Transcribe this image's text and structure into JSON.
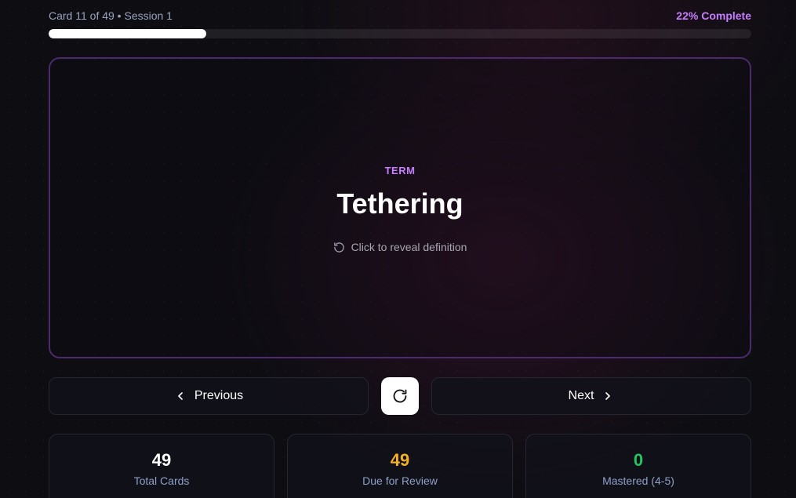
{
  "header": {
    "card_position": "Card 11 of 49 • Session 1",
    "completion_label": "22% Complete",
    "progress_fraction": 0.224
  },
  "card": {
    "label": "TERM",
    "term": "Tethering",
    "hint": "Click to reveal definition",
    "hint_icon": "rotate-icon"
  },
  "navigation": {
    "previous_label": "Previous",
    "next_label": "Next",
    "flip_icon": "rotate-icon"
  },
  "stats": [
    {
      "value": "49",
      "label": "Total Cards",
      "color": "#ffffff"
    },
    {
      "value": "49",
      "label": "Due for Review",
      "color": "#f5b125"
    },
    {
      "value": "0",
      "label": "Mastered (4-5)",
      "color": "#22c55e"
    }
  ],
  "colors": {
    "accent": "#c77dff",
    "card_border": "#4b2a6e",
    "background": "#0d0d12"
  }
}
